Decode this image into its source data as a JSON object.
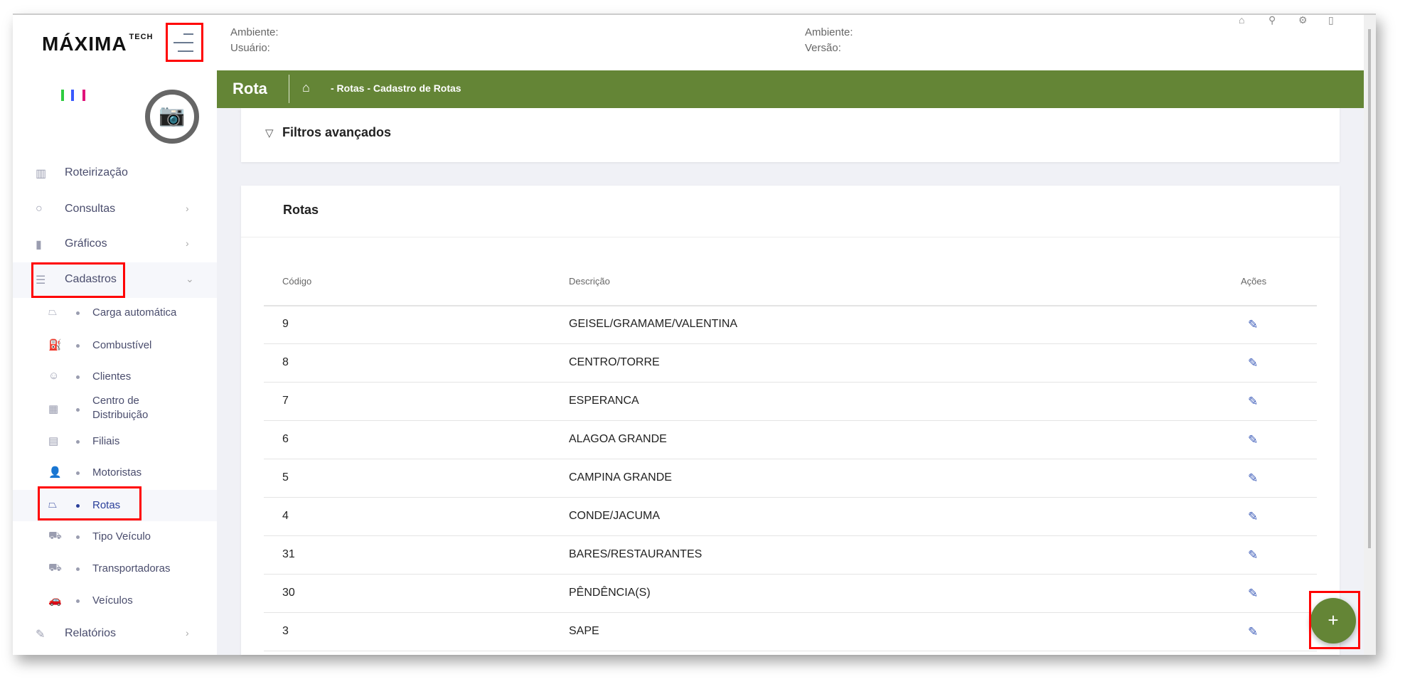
{
  "header": {
    "logo": "MÁXIMA",
    "logo_suffix": "TECH",
    "ambiente_label": "Ambiente:",
    "usuario_label": "Usuário:",
    "ambiente2_label": "Ambiente:",
    "versao_label": "Versão:",
    "icons": [
      "home-icon",
      "wrench-icon",
      "gear-icon",
      "document-icon"
    ]
  },
  "titlebar": {
    "title": "Rota",
    "breadcrumb": "- Rotas - Cadastro de Rotas"
  },
  "sidebar": {
    "items": [
      {
        "label": "Roteirização",
        "icon": "map-icon"
      },
      {
        "label": "Consultas",
        "icon": "search-icon"
      },
      {
        "label": "Gráficos",
        "icon": "bar-chart-icon"
      },
      {
        "label": "Cadastros",
        "icon": "list-icon"
      },
      {
        "label": "Relatórios",
        "icon": "edit-icon"
      }
    ],
    "sub_items": [
      {
        "label": "Carga automática"
      },
      {
        "label": "Combustível"
      },
      {
        "label": "Clientes"
      },
      {
        "label": "Centro de Distribuição"
      },
      {
        "label": "Filiais"
      },
      {
        "label": "Motoristas"
      },
      {
        "label": "Rotas"
      },
      {
        "label": "Tipo Veículo"
      },
      {
        "label": "Transportadoras"
      },
      {
        "label": "Veículos"
      }
    ]
  },
  "filters": {
    "title": "Filtros avançados"
  },
  "table": {
    "title": "Rotas",
    "columns": [
      "Código",
      "Descrição",
      "Ações"
    ],
    "rows": [
      {
        "codigo": "9",
        "descricao": "GEISEL/GRAMAME/VALENTINA"
      },
      {
        "codigo": "8",
        "descricao": "CENTRO/TORRE"
      },
      {
        "codigo": "7",
        "descricao": "ESPERANCA"
      },
      {
        "codigo": "6",
        "descricao": "ALAGOA GRANDE"
      },
      {
        "codigo": "5",
        "descricao": "CAMPINA GRANDE"
      },
      {
        "codigo": "4",
        "descricao": "CONDE/JACUMA"
      },
      {
        "codigo": "31",
        "descricao": "BARES/RESTAURANTES"
      },
      {
        "codigo": "30",
        "descricao": "PÊNDÊNCIA(S)"
      },
      {
        "codigo": "3",
        "descricao": "SAPE"
      }
    ]
  },
  "fab": {
    "label": "+"
  },
  "colors": {
    "brand_green": "#648536",
    "highlight": "#ff0000",
    "edit_blue": "#3a5ab8"
  }
}
